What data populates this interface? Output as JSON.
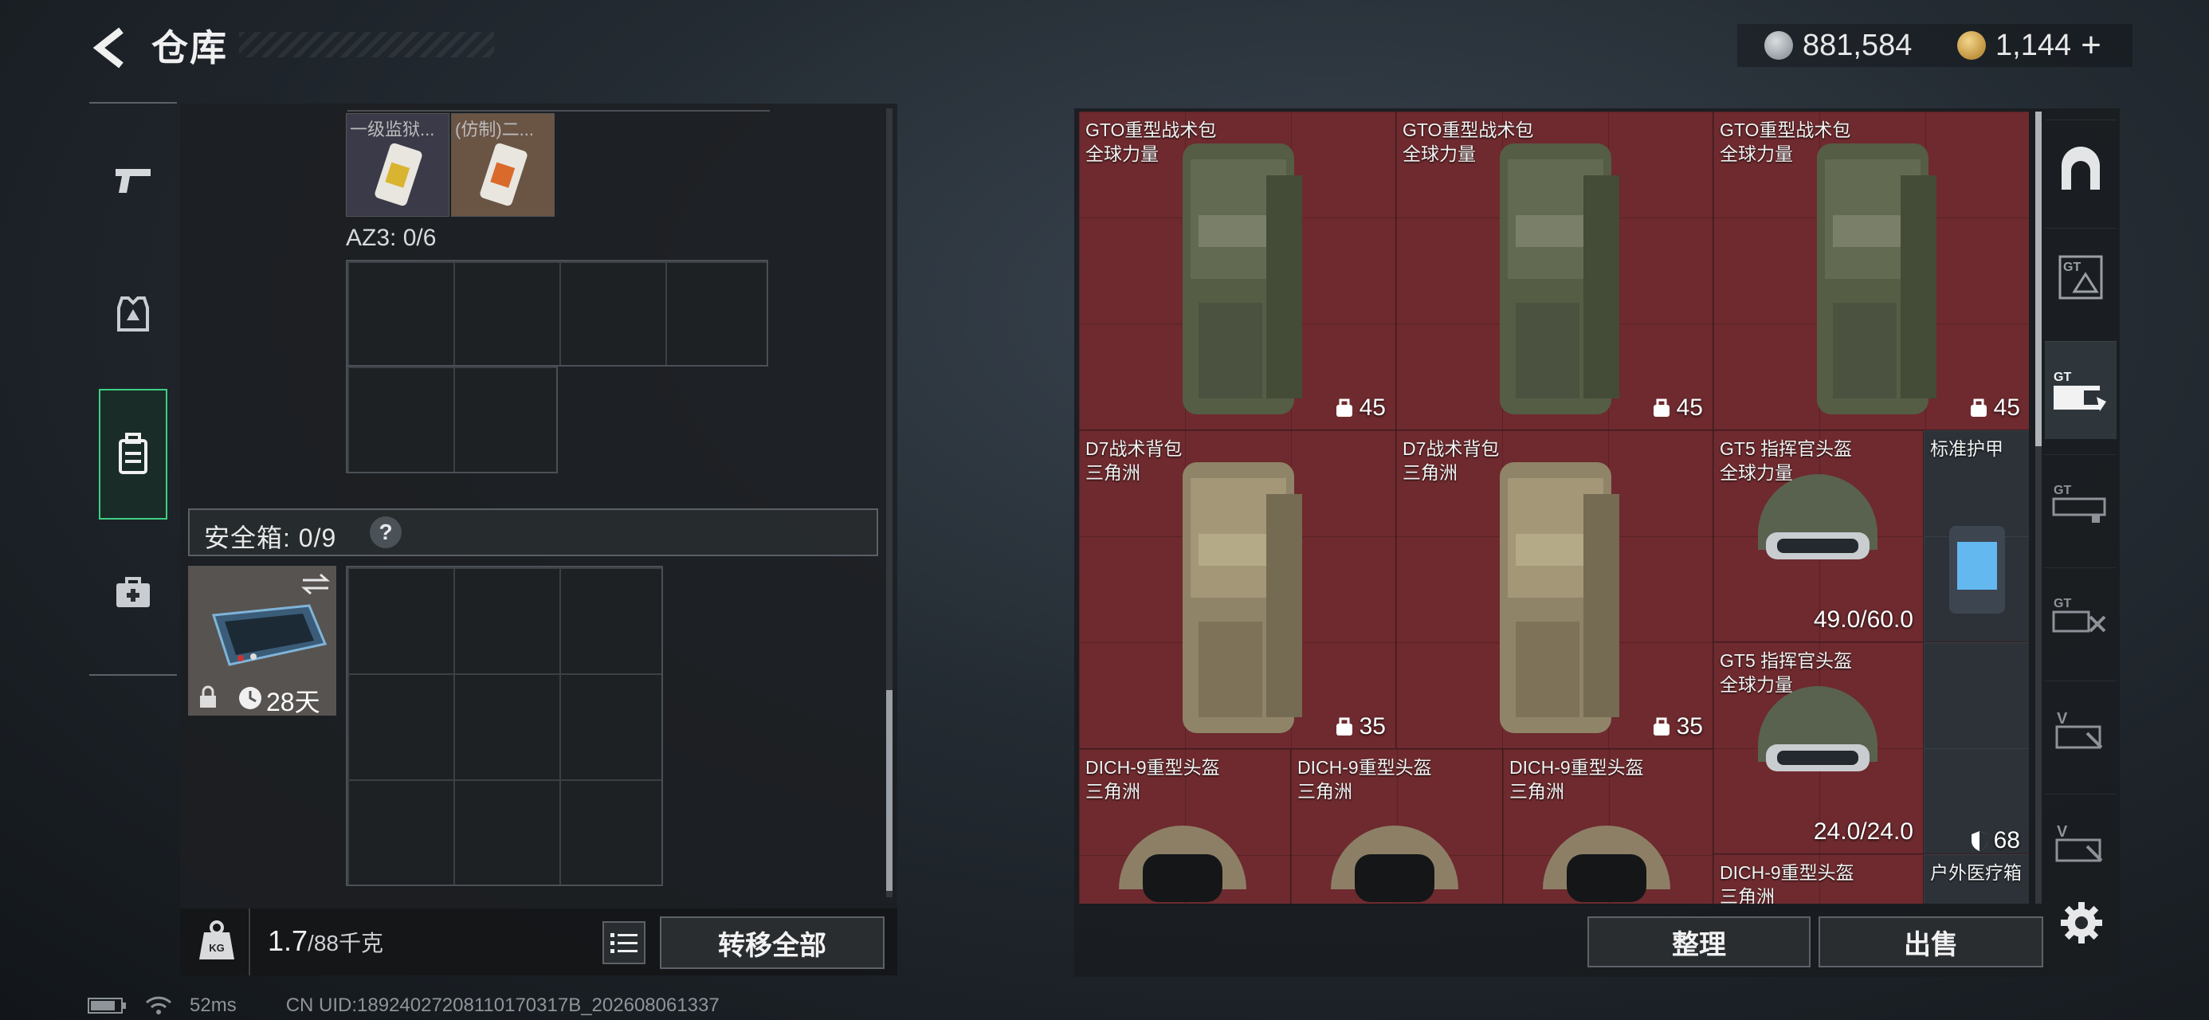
{
  "header": {
    "title": "仓库"
  },
  "currency": {
    "silver": "881,584",
    "gold": "1,144",
    "gold_plus": "+"
  },
  "sidebar": {
    "items": [
      {
        "icon": "pistol-icon"
      },
      {
        "icon": "armor-vest-icon"
      },
      {
        "icon": "backpack-icon",
        "active": true
      },
      {
        "icon": "medkit-icon"
      }
    ]
  },
  "left": {
    "top_cards": [
      {
        "label": "一级监狱..."
      },
      {
        "label": "(仿制)二..."
      }
    ],
    "az3_label": "AZ3: 0/6",
    "safe_label": "安全箱: 0/9",
    "safe_help": "?",
    "safe_case_time": "28天",
    "weight_value": "1.7",
    "weight_cap": "/88千克",
    "transfer_all": "转移全部"
  },
  "items": [
    {
      "name": "GTO重型战术包",
      "sub": "全球力量",
      "value": "45",
      "value_icon": "capacity-icon"
    },
    {
      "name": "GTO重型战术包",
      "sub": "全球力量",
      "value": "45",
      "value_icon": "capacity-icon"
    },
    {
      "name": "GTO重型战术包",
      "sub": "全球力量",
      "value": "45",
      "value_icon": "capacity-icon"
    },
    {
      "name": "D7战术背包",
      "sub": "三角洲",
      "value": "35",
      "value_icon": "capacity-icon"
    },
    {
      "name": "D7战术背包",
      "sub": "三角洲",
      "value": "35",
      "value_icon": "capacity-icon"
    },
    {
      "name": "GT5 指挥官头盔",
      "sub": "全球力量",
      "value": "49.0/60.0"
    },
    {
      "name": "标准护甲",
      "sub": ""
    },
    {
      "name": "GT5 指挥官头盔",
      "sub": "全球力量",
      "value": "24.0/24.0"
    },
    {
      "name": "",
      "sub": "",
      "value": "68",
      "value_icon": "shield-icon"
    },
    {
      "name": "户外医疗箱",
      "sub": ""
    },
    {
      "name": "DICH-9重型头盔",
      "sub": "三角洲"
    },
    {
      "name": "DICH-9重型头盔",
      "sub": "三角洲"
    },
    {
      "name": "DICH-9重型头盔",
      "sub": "三角洲"
    },
    {
      "name": "DICH-9重型头盔",
      "sub": "三角洲"
    }
  ],
  "right_buttons": {
    "sort": "整理",
    "sell": "出售"
  },
  "right_tabs": [
    {
      "icon": "arch-icon"
    },
    {
      "icon": "gt-crate-icon"
    },
    {
      "icon": "gt-storage-icon",
      "active": true
    },
    {
      "icon": "gt-rack-icon"
    },
    {
      "icon": "gt-tools-icon"
    },
    {
      "icon": "v-box-icon"
    },
    {
      "icon": "v-box-icon"
    }
  ],
  "status": {
    "ping": "52ms",
    "uid": "CN UID:18924027208110170317B_202608061337"
  },
  "colors": {
    "item_bg": "#6e2a2e",
    "accent_green": "#3ecf83"
  }
}
